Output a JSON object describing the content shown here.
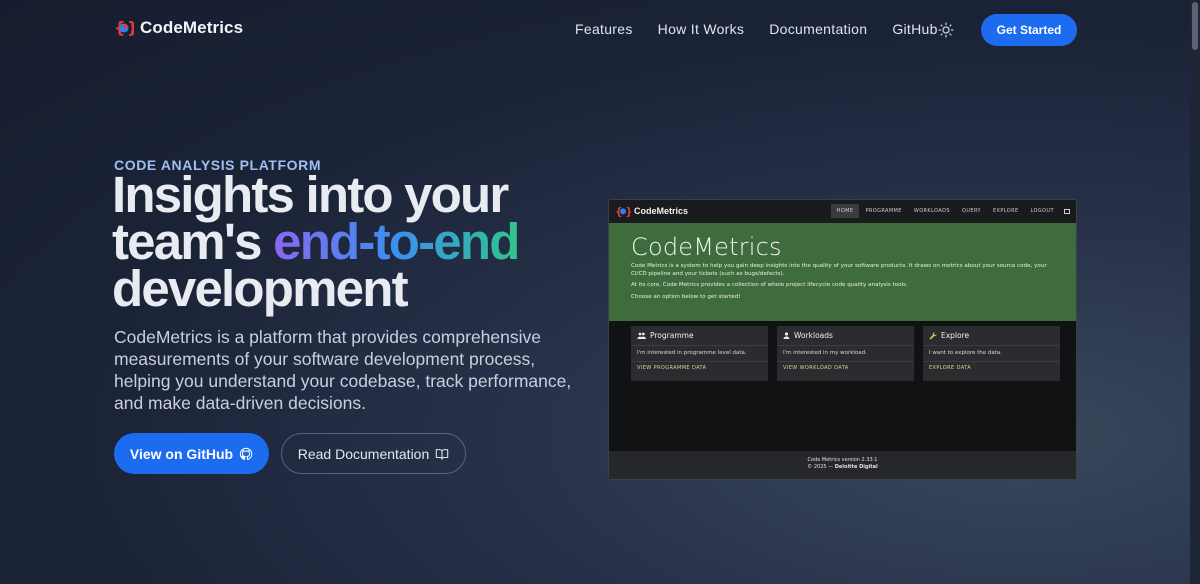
{
  "brand": {
    "name": "CodeMetrics"
  },
  "nav": {
    "links": [
      "Features",
      "How It Works",
      "Documentation",
      "GitHub"
    ],
    "theme_icon": "sun-icon",
    "cta_label": "Get Started"
  },
  "hero": {
    "eyebrow": "CODE ANALYSIS PLATFORM",
    "headline_part1": "Insights into your team's ",
    "headline_highlight": "end-to-end",
    "headline_part2": " development",
    "lead": "CodeMetrics is a platform that provides comprehensive measurements of your software development process, helping you understand your codebase, track performance, and make data-driven decisions.",
    "primary_button": "View on GitHub",
    "secondary_button": "Read Documentation"
  },
  "preview": {
    "brand": "CodeMetrics",
    "menu": [
      "HOME",
      "PROGRAMME",
      "WORKLOADS",
      "QUERY",
      "EXPLORE",
      "LOGOUT"
    ],
    "title": "CodeMetrics",
    "intro_1": "Code Metrics is a system to help you gain deep insights into the quality of your software products. It draws on metrics about your source code, your CI/CD pipeline and your tickets (such as bugs/defects).",
    "intro_2": "At its core, Code Metrics provides a collection of whole project lifecycle code quality analysis tools.",
    "intro_3": "Choose an option below to get started!",
    "cards": [
      {
        "title": "Programme",
        "icon": "group-icon",
        "body": "I'm interested in programme level data.",
        "link": "VIEW PROGRAMME DATA"
      },
      {
        "title": "Workloads",
        "icon": "user-icon",
        "body": "I'm interested in my workload.",
        "link": "VIEW WORKLOAD DATA"
      },
      {
        "title": "Explore",
        "icon": "wrench-icon",
        "body": "I want to explore the data.",
        "link": "EXPLORE DATA"
      }
    ],
    "footer_version": "Code Metrics version 2.33.1",
    "footer_copy": "© 2025 —",
    "footer_company": "Deloitte Digital"
  },
  "colors": {
    "accent": "#1d6cf0",
    "gradient_start": "#8a67f0",
    "gradient_mid": "#3c8ff0",
    "gradient_end": "#2fc58a",
    "preview_hero": "#3f6c3c"
  }
}
